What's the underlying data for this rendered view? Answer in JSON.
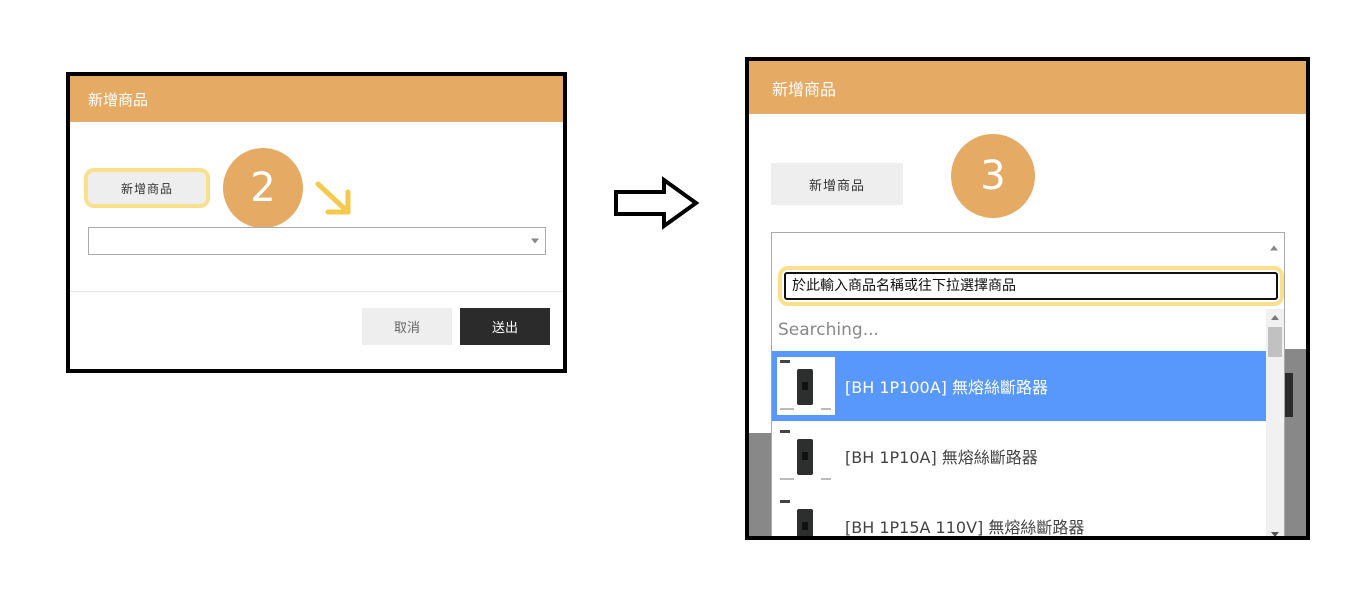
{
  "step_before": {
    "step_number": "2",
    "modal_title": "新增商品",
    "add_product_button": "新增商品",
    "select_value": "",
    "cancel_button": "取消",
    "submit_button": "送出"
  },
  "transition_arrow_icon": "hollow-right-arrow",
  "step_after": {
    "step_number": "3",
    "modal_title": "新增商品",
    "add_product_button": "新增商品",
    "search_placeholder": "於此輸入商品名稱或往下拉選擇商品",
    "searching_text": "Searching...",
    "results": [
      {
        "label": "[BH 1P100A] 無熔絲斷路器",
        "highlighted": true
      },
      {
        "label": "[BH 1P10A] 無熔絲斷路器",
        "highlighted": false
      },
      {
        "label": "[BH 1P15A 110V] 無熔絲斷路器",
        "highlighted": false
      }
    ]
  },
  "colors": {
    "header_orange": "#e5aa63",
    "highlight_yellow": "#fbe08c",
    "selected_blue": "#5897fb",
    "submit_dark": "#2b2b2b"
  }
}
